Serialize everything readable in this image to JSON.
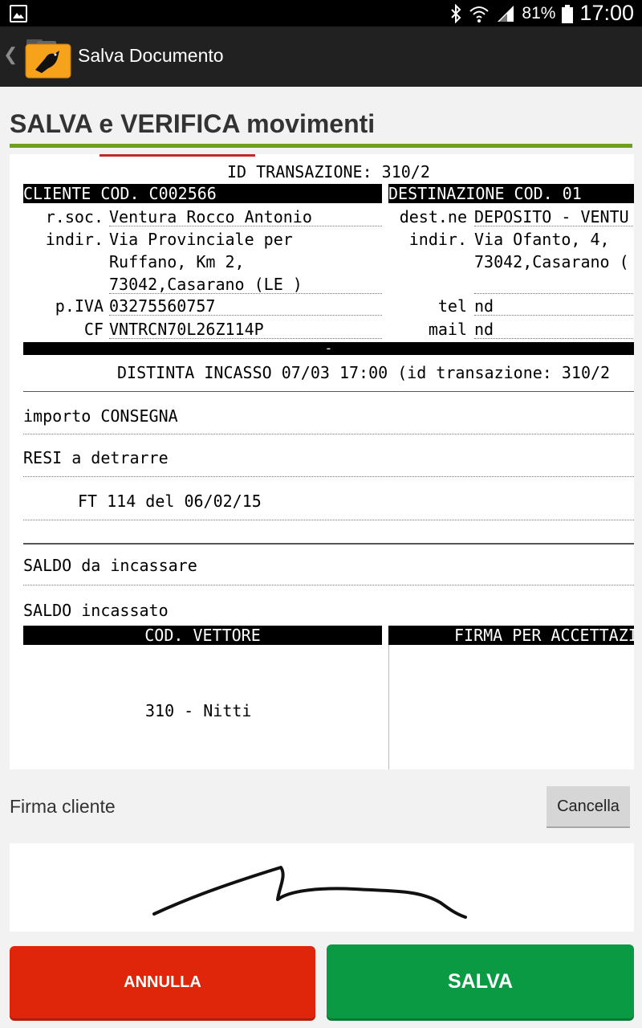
{
  "status_bar": {
    "battery_percent": "81%",
    "time": "17:00",
    "icons": [
      "image-icon",
      "bluetooth-icon",
      "wifi-icon",
      "signal-icon",
      "battery-icon"
    ]
  },
  "action_bar": {
    "title": "Salva Documento",
    "back_glyph": "❮",
    "logo_icon": "pigeon-briefcase-logo"
  },
  "page": {
    "title": "SALVA e VERIFICA movimenti",
    "accent_color": "#6ea01e"
  },
  "document": {
    "id_line": "ID TRANSAZIONE: 310/2",
    "cliente_header": "CLIENTE COD. C002566",
    "destinazione_header": "DESTINAZIONE COD. 01",
    "cliente": {
      "rsoc_label": "r.soc.",
      "rsoc_value": "Ventura Rocco Antonio",
      "indir_label": "indir.",
      "indir_line1": "Via Provinciale per",
      "indir_line2": "Ruffano, Km 2,",
      "indir_line3": "73042,Casarano (LE )",
      "piva_label": "p.IVA",
      "piva_value": "03275560757",
      "cf_label": "CF",
      "cf_value": "VNTRCN70L26Z114P"
    },
    "destinazione": {
      "destne_label": "dest.ne",
      "destne_value": "DEPOSITO - VENTU",
      "indir_label": "indir.",
      "indir_line1": "Via Ofanto, 4,",
      "indir_line2": "73042,Casarano (",
      "tel_label": "tel",
      "tel_value": "nd",
      "mail_label": "mail",
      "mail_value": "nd"
    },
    "black_bar_text": "-",
    "distinta": "DISTINTA INCASSO 07/03 17:00 (id transazione: 310/2",
    "importo_consegna": "importo CONSEGNA",
    "resi": "RESI a detrarre",
    "ft_line": "FT 114 del 06/02/15",
    "saldo_da_incassare": "SALDO da incassare",
    "saldo_incassato": "SALDO incassato",
    "cod_vettore_header": "COD. VETTORE",
    "firma_header": "FIRMA PER ACCETTAZIONE",
    "vettore_value": "310 - Nitti"
  },
  "signature": {
    "label": "Firma cliente",
    "cancel_label": "Cancella"
  },
  "buttons": {
    "annulla": "ANNULLA",
    "salva": "SALVA",
    "annulla_color": "#e0260a",
    "salva_color": "#0a9a43"
  }
}
